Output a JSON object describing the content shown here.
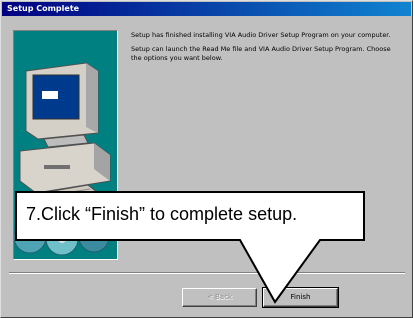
{
  "window": {
    "title": "Setup Complete"
  },
  "message": {
    "paragraph1": "Setup has finished installing VIA Audio Driver Setup Program on your computer.",
    "paragraph2": "Setup can launch the Read Me file and VIA Audio Driver Setup Program. Choose the options you want below."
  },
  "buttons": {
    "back_label": "< Back",
    "finish_label": "Finish"
  },
  "annotation": {
    "text": "7.Click “Finish” to complete setup."
  },
  "colors": {
    "titlebar_start": "#000080",
    "titlebar_end": "#1084d0",
    "dialog_background": "#c0c0c0",
    "art_background": "#008080"
  }
}
